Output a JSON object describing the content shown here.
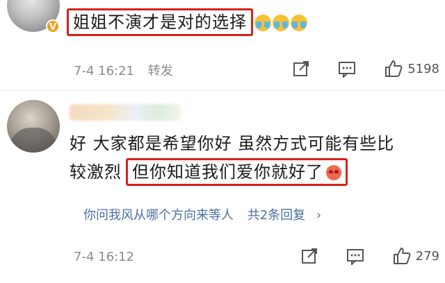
{
  "comments": [
    {
      "badge": "V",
      "text": "姐姐不演才是对的选择",
      "time": "7-4 16:21",
      "forward_label": "转发",
      "like_count": "5198"
    },
    {
      "text_part1": "好  大家都是希望你好  虽然方式可能有些比",
      "text_part2_plain": "较激烈",
      "text_part2_highlight": "但你知道我们爱你就好了",
      "replies_users": "你问我风从哪个方向来等人",
      "replies_count": "共2条回复",
      "replies_chevron": "›",
      "time": "7-4 16:12",
      "like_count": "279"
    }
  ],
  "colors": {
    "highlight_border": "#d8201c",
    "meta_text": "#8a8a8a",
    "link": "#4a6fa0"
  },
  "icons": [
    "share-icon",
    "comment-icon",
    "like-icon",
    "cry-emoji-icon",
    "heart-eyes-emoji-icon",
    "verified-badge-icon"
  ]
}
